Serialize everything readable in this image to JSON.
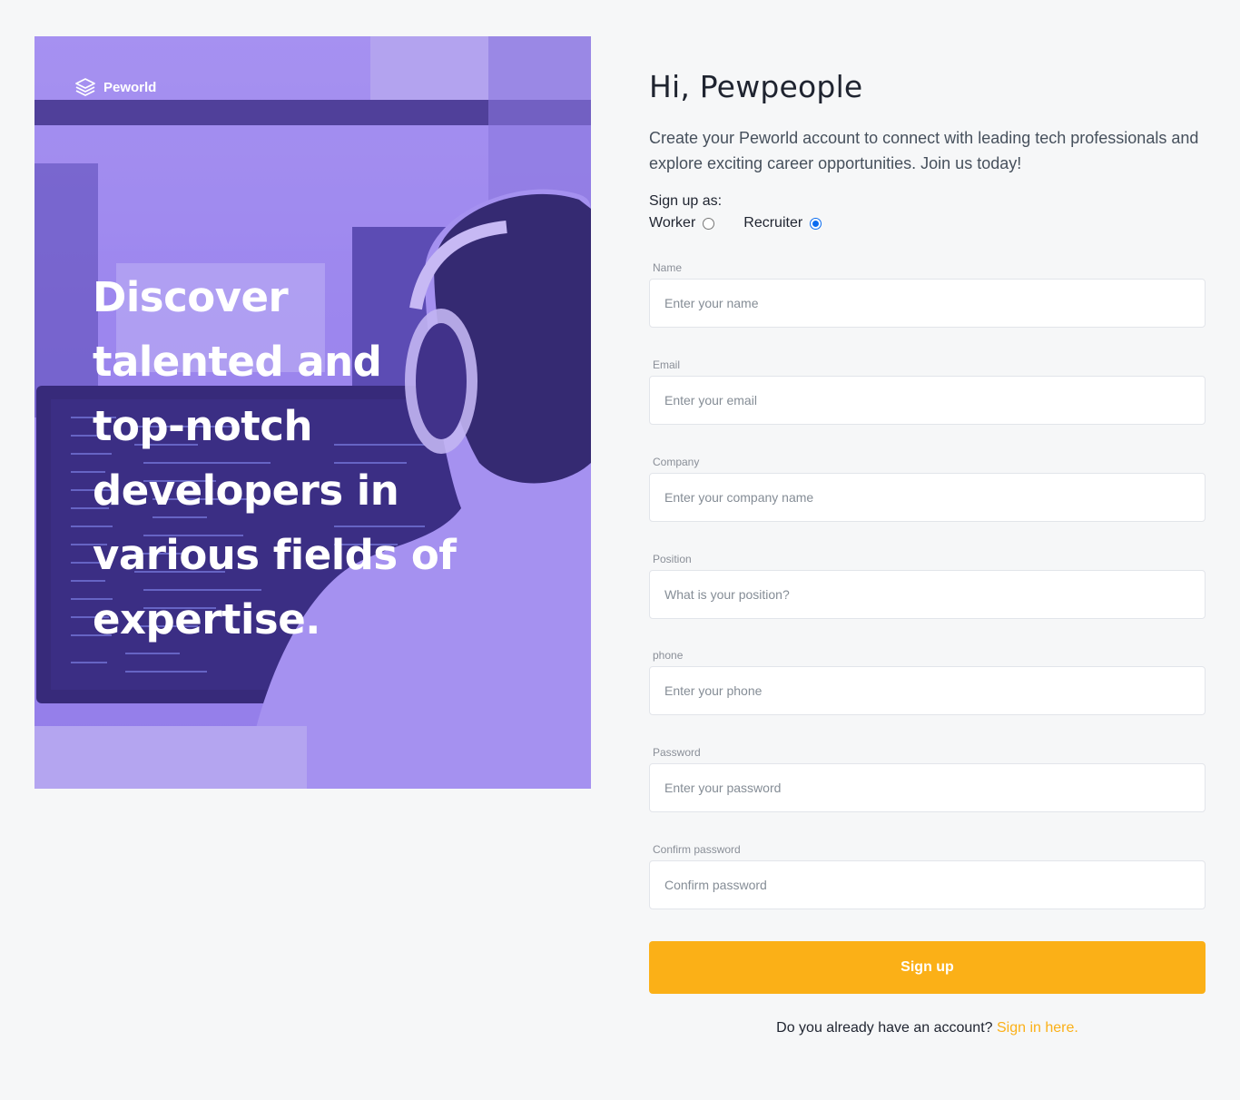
{
  "hero": {
    "brand": "Peworld",
    "headline": "Discover talented and top-notch developers in various fields of expertise."
  },
  "form": {
    "title": "Hi, Pewpeople",
    "description": "Create your Peworld account to connect with leading tech professionals and explore exciting career opportunities. Join us today!",
    "signup_as_label": "Sign up as:",
    "roles": [
      {
        "label": "Worker",
        "selected": false
      },
      {
        "label": "Recruiter",
        "selected": true
      }
    ],
    "fields": [
      {
        "label": "Name",
        "placeholder": "Enter your name"
      },
      {
        "label": "Email",
        "placeholder": "Enter your email"
      },
      {
        "label": "Company",
        "placeholder": "Enter your company name"
      },
      {
        "label": "Position",
        "placeholder": "What is your position?"
      },
      {
        "label": "phone",
        "placeholder": "Enter your phone"
      },
      {
        "label": "Password",
        "placeholder": "Enter your password"
      },
      {
        "label": "Confirm password",
        "placeholder": "Confirm password"
      }
    ],
    "submit_label": "Sign up",
    "signin_prompt": "Do you already have an account?",
    "signin_link": "Sign in here."
  },
  "colors": {
    "accent": "#fbb017",
    "hero_overlay": "#7c62e8",
    "radio_checked": "#0b6cf0"
  }
}
